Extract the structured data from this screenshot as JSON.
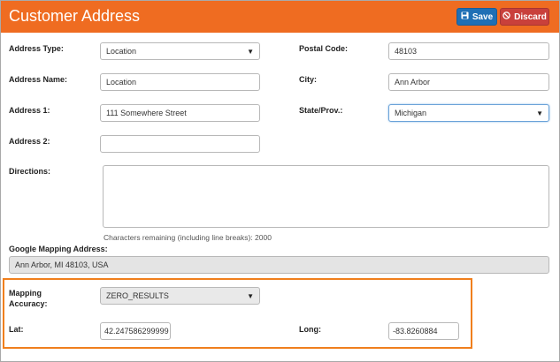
{
  "header": {
    "title": "Customer Address",
    "save_label": "Save",
    "discard_label": "Discard",
    "save_icon": "floppy-disk-icon",
    "discard_icon": "cancel-circle-icon"
  },
  "form": {
    "address_type": {
      "label": "Address Type:",
      "value": "Location"
    },
    "postal_code": {
      "label": "Postal Code:",
      "value": "48103"
    },
    "address_name": {
      "label": "Address Name:",
      "value": "Location"
    },
    "city": {
      "label": "City:",
      "value": "Ann Arbor"
    },
    "address1": {
      "label": "Address 1:",
      "value": "111 Somewhere Street"
    },
    "state": {
      "label": "State/Prov.:",
      "value": "Michigan"
    },
    "address2": {
      "label": "Address 2:",
      "value": ""
    },
    "directions": {
      "label": "Directions:",
      "value": "",
      "note": "Characters remaining (including line breaks): 2000"
    },
    "google_address": {
      "label": "Google Mapping Address:",
      "value": "Ann Arbor, MI 48103, USA"
    },
    "mapping_accuracy": {
      "label_line1": "Mapping",
      "label_line2": "Accuracy:",
      "value": "ZERO_RESULTS"
    },
    "lat": {
      "label": "Lat:",
      "value": "42.247586299999"
    },
    "long": {
      "label": "Long:",
      "value": "-83.8260884"
    }
  },
  "colors": {
    "header": "#ef6c21",
    "save": "#1f6fb5",
    "discard": "#c9403b",
    "highlight_border": "#f07f1d"
  }
}
